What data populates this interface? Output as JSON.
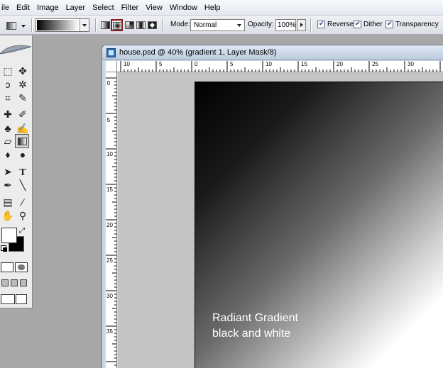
{
  "menu": {
    "items": [
      "ile",
      "Edit",
      "Image",
      "Layer",
      "Select",
      "Filter",
      "View",
      "Window",
      "Help"
    ]
  },
  "options_bar": {
    "mode_label": "Mode:",
    "mode_value": "Normal",
    "opacity_label": "Opacity:",
    "opacity_value": "100%",
    "reverse_label": "Reverse",
    "dither_label": "Dither",
    "transparency_label": "Transparency",
    "reverse_checked": true,
    "dither_checked": true,
    "transparency_checked": true,
    "selected_gradient_type": "radial",
    "gradient_types": [
      "linear",
      "radial",
      "angle",
      "reflected",
      "diamond"
    ]
  },
  "toolbox": {
    "active_tool": "gradient-tool",
    "foreground_color": "#ffffff",
    "background_color": "#000000"
  },
  "document": {
    "title": "house.psd @ 40% (gradient 1, Layer Mask/8)",
    "hruler_labels": [
      "10",
      "5",
      "0",
      "5",
      "10",
      "15",
      "20",
      "25",
      "30"
    ],
    "vruler_labels": [
      "0",
      "5",
      "10",
      "15",
      "20",
      "25",
      "30",
      "35"
    ],
    "caption_line1": "Radiant Gradient",
    "caption_line2": "black and white"
  },
  "colors": {
    "radial_highlight": "#8b1a1a",
    "workspace": "#a7a7a7"
  }
}
